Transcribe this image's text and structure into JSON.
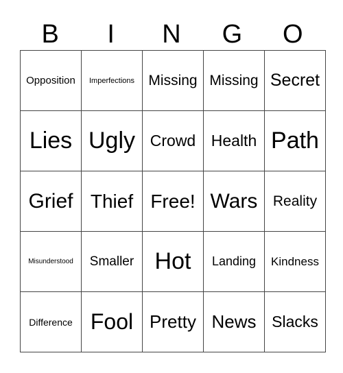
{
  "header": [
    "B",
    "I",
    "N",
    "G",
    "O"
  ],
  "rows": [
    [
      {
        "t": "Opposition",
        "s": 15
      },
      {
        "t": "Imperfections",
        "s": 11
      },
      {
        "t": "Missing",
        "s": 21
      },
      {
        "t": "Missing",
        "s": 21
      },
      {
        "t": "Secret",
        "s": 25
      }
    ],
    [
      {
        "t": "Lies",
        "s": 34
      },
      {
        "t": "Ugly",
        "s": 34
      },
      {
        "t": "Crowd",
        "s": 23
      },
      {
        "t": "Health",
        "s": 23
      },
      {
        "t": "Path",
        "s": 34
      }
    ],
    [
      {
        "t": "Grief",
        "s": 30
      },
      {
        "t": "Thief",
        "s": 28
      },
      {
        "t": "Free!",
        "s": 28
      },
      {
        "t": "Wars",
        "s": 30
      },
      {
        "t": "Reality",
        "s": 21
      }
    ],
    [
      {
        "t": "Misunderstood",
        "s": 10
      },
      {
        "t": "Smaller",
        "s": 19
      },
      {
        "t": "Hot",
        "s": 34
      },
      {
        "t": "Landing",
        "s": 18
      },
      {
        "t": "Kindness",
        "s": 17
      }
    ],
    [
      {
        "t": "Difference",
        "s": 14
      },
      {
        "t": "Fool",
        "s": 32
      },
      {
        "t": "Pretty",
        "s": 26
      },
      {
        "t": "News",
        "s": 26
      },
      {
        "t": "Slacks",
        "s": 23
      }
    ]
  ]
}
